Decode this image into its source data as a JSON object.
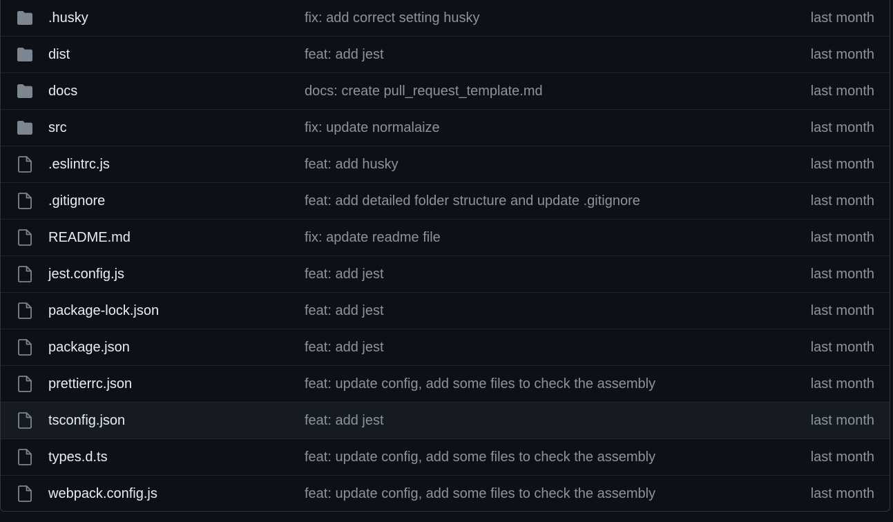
{
  "colors": {
    "background": "#0d1117",
    "border": "#30363d",
    "row_divider": "#21262d",
    "highlight_row": "#161b22",
    "file_name": "#e6edf3",
    "muted_text": "#8b949e",
    "folder_icon": "#7d8590"
  },
  "files": [
    {
      "icon": "folder-icon",
      "name": ".husky",
      "message": "fix: add correct setting husky",
      "age": "last month"
    },
    {
      "icon": "folder-icon",
      "name": "dist",
      "message": "feat: add jest",
      "age": "last month"
    },
    {
      "icon": "folder-icon",
      "name": "docs",
      "message": "docs: create pull_request_template.md",
      "age": "last month"
    },
    {
      "icon": "folder-icon",
      "name": "src",
      "message": "fix: update normalaize",
      "age": "last month"
    },
    {
      "icon": "file-icon",
      "name": ".eslintrc.js",
      "message": "feat: add husky",
      "age": "last month"
    },
    {
      "icon": "file-icon",
      "name": ".gitignore",
      "message": "feat: add detailed folder structure and update .gitignore",
      "age": "last month"
    },
    {
      "icon": "file-icon",
      "name": "README.md",
      "message": "fix: apdate readme file",
      "age": "last month"
    },
    {
      "icon": "file-icon",
      "name": "jest.config.js",
      "message": "feat: add jest",
      "age": "last month"
    },
    {
      "icon": "file-icon",
      "name": "package-lock.json",
      "message": "feat: add jest",
      "age": "last month"
    },
    {
      "icon": "file-icon",
      "name": "package.json",
      "message": "feat: add jest",
      "age": "last month"
    },
    {
      "icon": "file-icon",
      "name": "prettierrc.json",
      "message": "feat: update config, add some files to check the assembly",
      "age": "last month"
    },
    {
      "icon": "file-icon",
      "name": "tsconfig.json",
      "message": "feat: add jest",
      "age": "last month",
      "highlighted": true
    },
    {
      "icon": "file-icon",
      "name": "types.d.ts",
      "message": "feat: update config, add some files to check the assembly",
      "age": "last month"
    },
    {
      "icon": "file-icon",
      "name": "webpack.config.js",
      "message": "feat: update config, add some files to check the assembly",
      "age": "last month"
    }
  ]
}
